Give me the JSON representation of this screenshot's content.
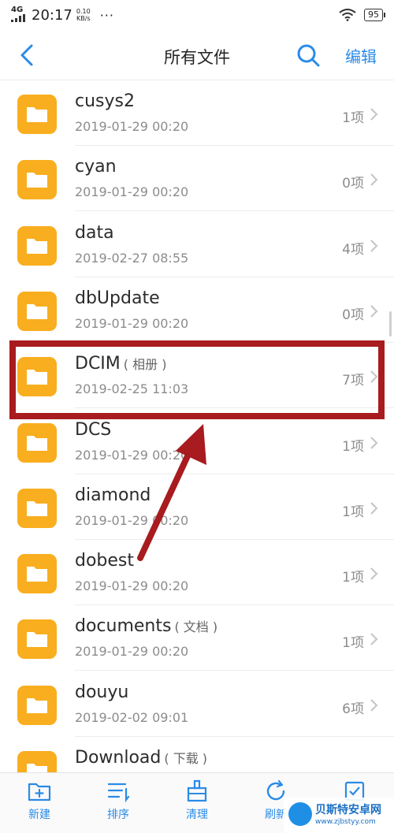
{
  "status_bar": {
    "network": "4G",
    "time": "20:17",
    "speed_value": "0.10",
    "speed_unit": "KB/s",
    "dots": "···",
    "battery": "95"
  },
  "header": {
    "title": "所有文件",
    "edit_label": "编辑"
  },
  "files": [
    {
      "name": "cusys2",
      "tag": "",
      "date": "2019-01-29 00:20",
      "count": "1项"
    },
    {
      "name": "cyan",
      "tag": "",
      "date": "2019-01-29 00:20",
      "count": "0项"
    },
    {
      "name": "data",
      "tag": "",
      "date": "2019-02-27 08:55",
      "count": "4项"
    },
    {
      "name": "dbUpdate",
      "tag": "",
      "date": "2019-01-29 00:20",
      "count": "0项"
    },
    {
      "name": "DCIM",
      "tag": "( 相册 )",
      "date": "2019-02-25 11:03",
      "count": "7项"
    },
    {
      "name": "DCS",
      "tag": "",
      "date": "2019-01-29 00:20",
      "count": "1项"
    },
    {
      "name": "diamond",
      "tag": "",
      "date": "2019-01-29 00:20",
      "count": "1项"
    },
    {
      "name": "dobest",
      "tag": "",
      "date": "2019-01-29 00:20",
      "count": "1项"
    },
    {
      "name": "documents",
      "tag": "( 文档 )",
      "date": "2019-01-29 00:20",
      "count": "1项"
    },
    {
      "name": "douyu",
      "tag": "",
      "date": "2019-02-02 09:01",
      "count": "6项"
    },
    {
      "name": "Download",
      "tag": "( 下载 )",
      "date": "",
      "count": ""
    }
  ],
  "toolbar": {
    "new_label": "新建",
    "sort_label": "排序",
    "clean_label": "清理",
    "refresh_label": "刷新"
  },
  "watermark": {
    "title": "贝斯特安卓网",
    "url": "www.zjbstyy.com"
  },
  "colors": {
    "accent": "#2a8be8",
    "folder": "#f9ae1f",
    "highlight": "#a81b1f"
  }
}
